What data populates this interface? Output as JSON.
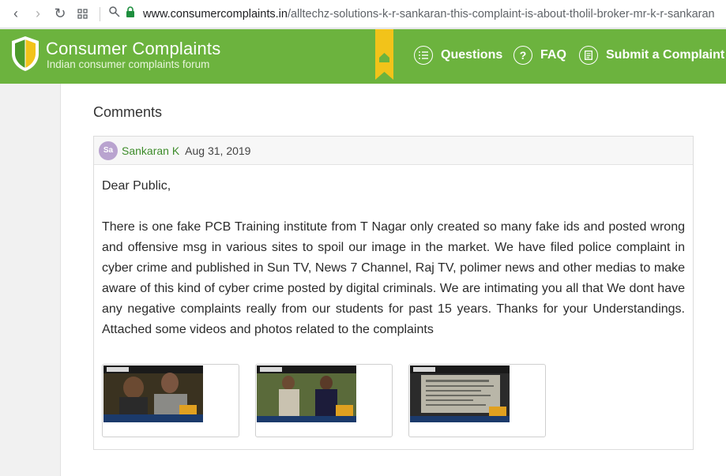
{
  "browser": {
    "url_host": "www.consumercomplaints.in",
    "url_path": "/alltechz-solutions-k-r-sankaran-this-complaint-is-about-tholil-broker-mr-k-r-sankaran"
  },
  "header": {
    "brand_title": "Consumer Complaints",
    "brand_subtitle": "Indian consumer complaints forum",
    "nav": {
      "questions": "Questions",
      "faq": "FAQ",
      "submit": "Submit a Complaint"
    },
    "colors": {
      "brand_green": "#6cb33e",
      "bookmark_yellow": "#f2c31a"
    }
  },
  "main": {
    "section_title": "Comments",
    "comment": {
      "avatar_initials": "Sa",
      "author": "Sankaran K",
      "date": "Aug 31, 2019",
      "greeting": "Dear Public,",
      "body": "There is one fake PCB Training institute from T Nagar only created so many fake ids and posted wrong and offensive msg in various sites to spoil our image in the market. We have filed police complaint in cyber crime and published in Sun TV, News 7 Channel, Raj TV, polimer news and other medias to make aware of this kind of cyber crime posted by digital criminals. We are intimating you all that We dont have any negative complaints really from our students for past 15 years. Thanks for your Understandings. Attached some videos and photos related to the complaints",
      "attachments": [
        {
          "kind": "video-thumbnail"
        },
        {
          "kind": "video-thumbnail"
        },
        {
          "kind": "video-thumbnail"
        }
      ]
    }
  }
}
